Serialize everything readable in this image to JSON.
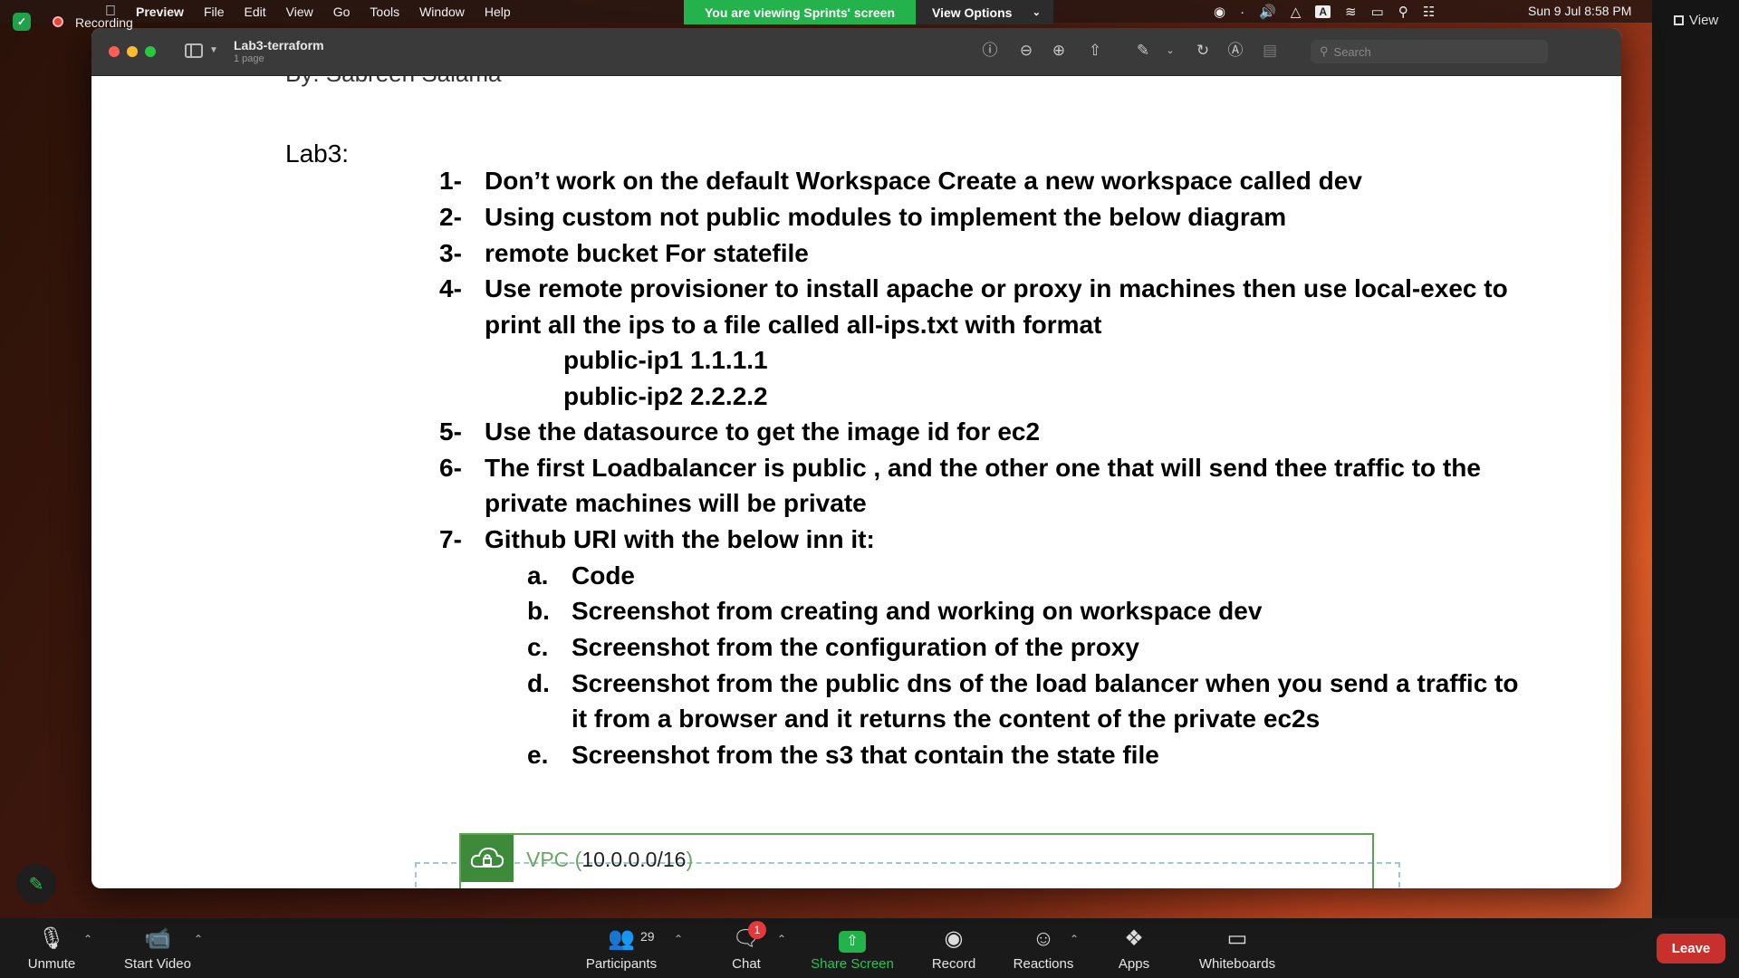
{
  "menubar": {
    "app": "Preview",
    "items": [
      "File",
      "Edit",
      "View",
      "Go",
      "Tools",
      "Window",
      "Help"
    ],
    "clock": "Sun 9 Jul  8:58 PM"
  },
  "share": {
    "banner": "You are viewing Sprints' screen",
    "view_options": "View Options"
  },
  "zoom_top": {
    "recording": "Recording",
    "view": "View"
  },
  "preview": {
    "title": "Lab3-terraform",
    "subtitle": "1 page",
    "search_placeholder": "Search"
  },
  "document": {
    "cut_line": "By: Sabreen Salama",
    "lab_title": "Lab3:",
    "items": [
      {
        "num": "1-",
        "text": "Don’t work on the default Workspace Create a new workspace called dev"
      },
      {
        "num": "2-",
        "text": "Using custom not public modules to implement the below diagram"
      },
      {
        "num": "3-",
        "text": " remote bucket For statefile"
      },
      {
        "num": "4-",
        "text": "Use remote provisioner to install apache or proxy in machines then use local-exec to"
      },
      {
        "num": "",
        "text": "print all the ips to a file called all-ips.txt with format"
      },
      {
        "num": "",
        "text": "public-ip1   1.1.1.1"
      },
      {
        "num": "",
        "text": "public-ip2   2.2.2.2"
      },
      {
        "num": "5-",
        "text": "Use the datasource to get the image id for ec2"
      },
      {
        "num": "6-",
        "text": "The first Loadbalancer  is public , and the other one that will send thee traffic to the"
      },
      {
        "num": "",
        "text": "private machines will be private"
      },
      {
        "num": "7-",
        "text": "Github URl with the below inn it:"
      },
      {
        "num": "a.",
        "text": "Code"
      },
      {
        "num": "b.",
        "text": "Screenshot from creating and working on workspace dev"
      },
      {
        "num": "c.",
        "text": "Screenshot from the configuration of the proxy"
      },
      {
        "num": "d.",
        "text": "Screenshot from the public dns of the load balancer when you send a traffic to"
      },
      {
        "num": "",
        "text": "it from a browser and it returns the content of the private ec2s"
      },
      {
        "num": "e.",
        "text": "Screenshot from the s3 that contain the state file"
      }
    ],
    "vpc_label": "VPC (",
    "vpc_cidr": "10.0.0.0/16",
    "vpc_close": ")"
  },
  "zoom_bar": {
    "unmute": "Unmute",
    "start_video": "Start Video",
    "participants": "Participants",
    "participants_count": "29",
    "chat": "Chat",
    "chat_badge": "1",
    "share_screen": "Share Screen",
    "record": "Record",
    "reactions": "Reactions",
    "apps": "Apps",
    "whiteboards": "Whiteboards",
    "leave": "Leave"
  },
  "colors": {
    "zoom_green": "#23b24b",
    "leave_red": "#c7302d",
    "badge_red": "#e5383b",
    "vpc_green": "#3d8a3a"
  }
}
